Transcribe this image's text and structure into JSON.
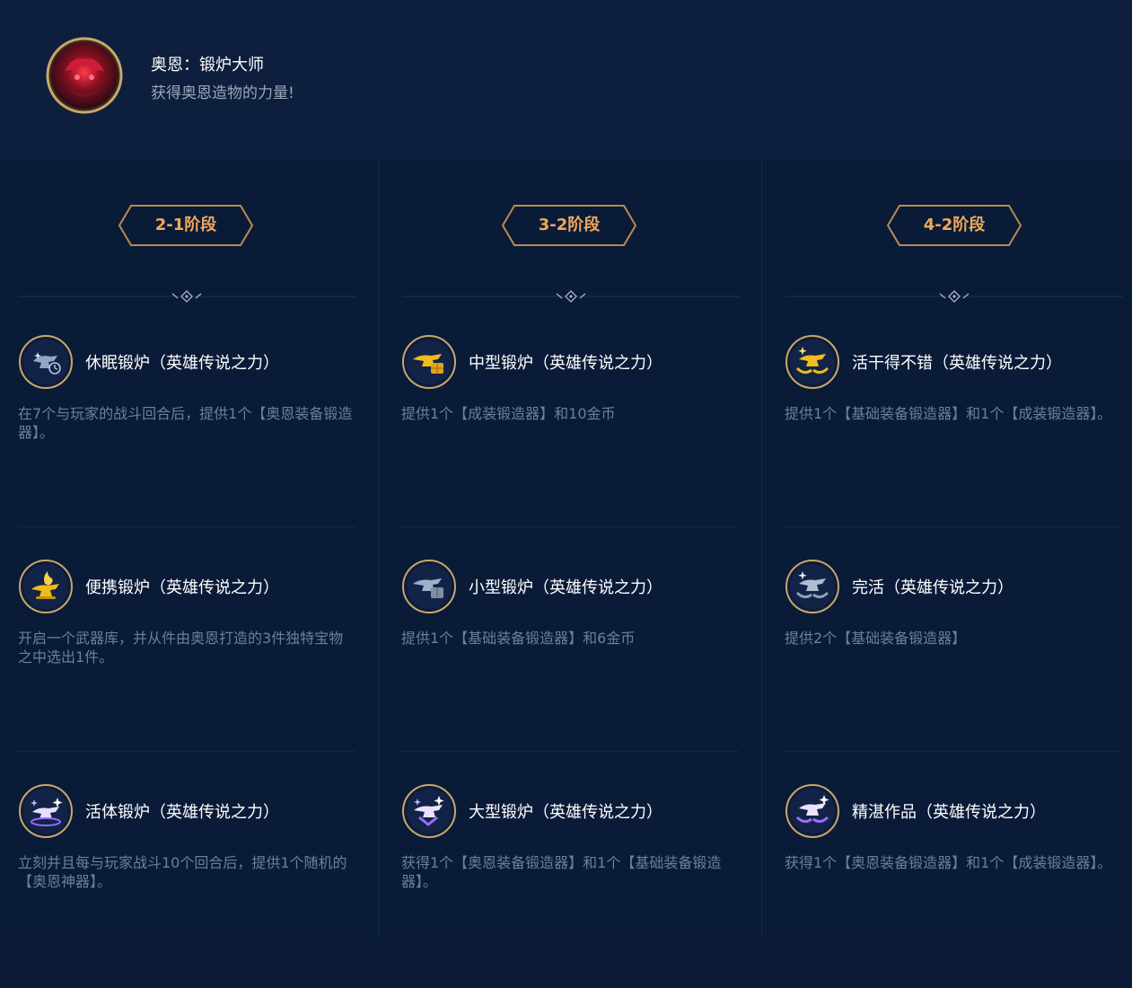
{
  "header": {
    "title": "奥恩：锻炉大师",
    "subtitle": "获得奥恩造物的力量!"
  },
  "columns": [
    {
      "stage": "2-1阶段",
      "items": [
        {
          "name": "休眠锻炉（英雄传说之力）",
          "desc": "在7个与玩家的战斗回合后，提供1个【奥恩装备锻造器】。",
          "icon": "dormant-forge-icon"
        },
        {
          "name": "便携锻炉（英雄传说之力）",
          "desc": "开启一个武器库，并从件由奥恩打造的3件独特宝物之中选出1件。",
          "icon": "portable-forge-icon"
        },
        {
          "name": "活体锻炉（英雄传说之力）",
          "desc": "立刻并且每与玩家战斗10个回合后，提供1个随机的【奥恩神器】。",
          "icon": "living-forge-icon"
        }
      ]
    },
    {
      "stage": "3-2阶段",
      "items": [
        {
          "name": "中型锻炉（英雄传说之力）",
          "desc": "提供1个【成装锻造器】和10金币",
          "icon": "medium-forge-icon"
        },
        {
          "name": "小型锻炉（英雄传说之力）",
          "desc": "提供1个【基础装备锻造器】和6金币",
          "icon": "small-forge-icon"
        },
        {
          "name": "大型锻炉（英雄传说之力）",
          "desc": "获得1个【奥恩装备锻造器】和1个【基础装备锻造器】。",
          "icon": "large-forge-icon"
        }
      ]
    },
    {
      "stage": "4-2阶段",
      "items": [
        {
          "name": "活干得不错（英雄传说之力）",
          "desc": "提供1个【基础装备锻造器】和1个【成装锻造器】。",
          "icon": "good-work-icon"
        },
        {
          "name": "完活（英雄传说之力）",
          "desc": "提供2个【基础装备锻造器】",
          "icon": "job-done-icon"
        },
        {
          "name": "精湛作品（英雄传说之力）",
          "desc": "获得1个【奥恩装备锻造器】和1个【成装锻造器】。",
          "icon": "masterwork-icon"
        }
      ]
    }
  ],
  "colors": {
    "stage_text": "#f0a85a",
    "stage_border": "#b98a52",
    "icon_ring": "#c9a66b",
    "background": "#0a1b38"
  }
}
